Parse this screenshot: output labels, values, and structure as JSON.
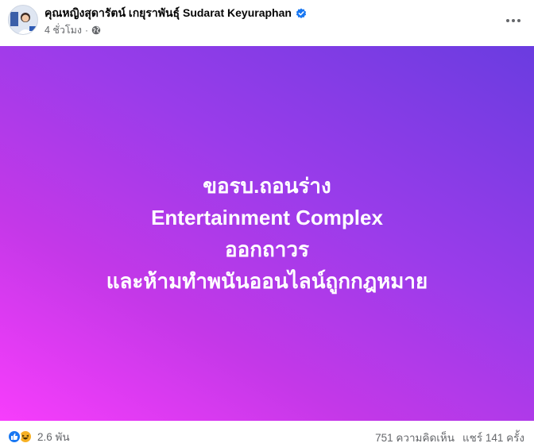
{
  "post": {
    "author": "คุณหญิงสุดารัตน์ เกยุราพันธุ์ Sudarat Keyuraphan",
    "timestamp": "4 ชั่วโมง",
    "separator": "·",
    "icons": {
      "verified": "verified-badge-icon",
      "audience": "globe-icon",
      "more": "more-options-icon"
    },
    "colors": {
      "verified": "#1877f2",
      "gradient_start": "#f73dfc",
      "gradient_end": "#6a3ce0",
      "meta_text": "#65676b"
    }
  },
  "banner": {
    "lines": [
      "ขอรบ.ถอนร่าง",
      "Entertainment Complex",
      "ออกถาวร",
      "และห้ามทำพนันออนไลน์ถูกกฎหมาย"
    ]
  },
  "footer": {
    "reaction_icons": [
      "like-icon",
      "haha-icon"
    ],
    "reaction_count": "2.6 พัน",
    "comments": "751 ความคิดเห็น",
    "shares": "แชร์ 141 ครั้ง"
  }
}
